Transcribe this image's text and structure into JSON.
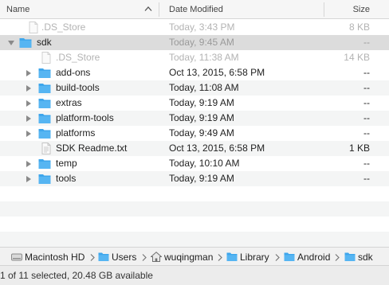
{
  "columns": {
    "name": "Name",
    "date": "Date Modified",
    "size": "Size"
  },
  "rows": [
    {
      "name": ".DS_Store",
      "date": "Today, 3:43 PM",
      "size": "8 KB"
    },
    {
      "name": "sdk",
      "date": "Today, 9:45 AM",
      "size": "--"
    },
    {
      "name": ".DS_Store",
      "date": "Today, 11:38 AM",
      "size": "14 KB"
    },
    {
      "name": "add-ons",
      "date": "Oct 13, 2015, 6:58 PM",
      "size": "--"
    },
    {
      "name": "build-tools",
      "date": "Today, 11:08 AM",
      "size": "--"
    },
    {
      "name": "extras",
      "date": "Today, 9:19 AM",
      "size": "--"
    },
    {
      "name": "platform-tools",
      "date": "Today, 9:19 AM",
      "size": "--"
    },
    {
      "name": "platforms",
      "date": "Today, 9:49 AM",
      "size": "--"
    },
    {
      "name": "SDK Readme.txt",
      "date": "Oct 13, 2015, 6:58 PM",
      "size": "1 KB"
    },
    {
      "name": "temp",
      "date": "Today, 10:10 AM",
      "size": "--"
    },
    {
      "name": "tools",
      "date": "Today, 9:19 AM",
      "size": "--"
    }
  ],
  "pathbar": {
    "items": [
      {
        "label": "Macintosh HD",
        "icon": "hard-drive-icon"
      },
      {
        "label": "Users",
        "icon": "folder-icon"
      },
      {
        "label": "wuqingman",
        "icon": "home-icon"
      },
      {
        "label": "Library",
        "icon": "folder-icon"
      },
      {
        "label": "Android",
        "icon": "folder-icon"
      },
      {
        "label": "sdk",
        "icon": "folder-icon"
      }
    ]
  },
  "status": {
    "text": "1 of 11 selected, 20.48 GB available"
  },
  "colors": {
    "folder": "#3ea6ec",
    "selection": "#dcdcdc",
    "dim_text": "#b3b3b3"
  }
}
